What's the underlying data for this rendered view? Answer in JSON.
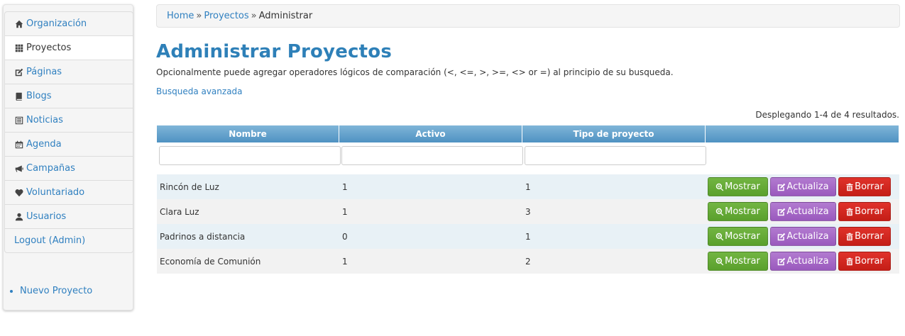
{
  "sidebar": {
    "items": [
      {
        "label": "Organización",
        "icon": "home-icon",
        "active": false
      },
      {
        "label": "Proyectos",
        "icon": "grid-icon",
        "active": true
      },
      {
        "label": "Páginas",
        "icon": "edit-icon",
        "active": false
      },
      {
        "label": "Blogs",
        "icon": "book-icon",
        "active": false
      },
      {
        "label": "Noticias",
        "icon": "list-icon",
        "active": false
      },
      {
        "label": "Agenda",
        "icon": "calendar-icon",
        "active": false
      },
      {
        "label": "Campañas",
        "icon": "bullhorn-icon",
        "active": false
      },
      {
        "label": "Voluntariado",
        "icon": "heart-icon",
        "active": false
      },
      {
        "label": "Usuarios",
        "icon": "user-icon",
        "active": false
      },
      {
        "label": "Logout (Admin)",
        "icon": "",
        "active": false
      }
    ],
    "operations": [
      "Nuevo Proyecto"
    ]
  },
  "breadcrumb": {
    "home": "Home",
    "separator": "»",
    "section": "Proyectos",
    "current": "Administrar"
  },
  "page": {
    "title": "Administrar Proyectos",
    "description": "Opcionalmente puede agregar operadores lógicos de comparación (<, <=, >, >=, <> or =) al principio de su busqueda.",
    "advanced_search": "Busqueda avanzada",
    "summary": "Desplegando 1-4 de 4 resultados."
  },
  "grid": {
    "columns": [
      "Nombre",
      "Activo",
      "Tipo de proyecto",
      ""
    ],
    "filters": [
      "",
      "",
      ""
    ],
    "buttons": {
      "show": "Mostrar",
      "edit": "Actualiza",
      "delete": "Borrar"
    },
    "rows": [
      {
        "nombre": "Rincón de Luz",
        "activo": "1",
        "tipo": "1"
      },
      {
        "nombre": "Clara Luz",
        "activo": "1",
        "tipo": "3"
      },
      {
        "nombre": "Padrinos a distancia",
        "activo": "0",
        "tipo": "1"
      },
      {
        "nombre": "Economía de Comunión",
        "activo": "1",
        "tipo": "2"
      }
    ]
  },
  "colors": {
    "link": "#3080c0",
    "title": "#2e80b8",
    "header_gradient_top": "#7fb5d8",
    "header_gradient_bottom": "#4f92c2",
    "row_odd": "#e8f1f6",
    "row_even": "#f2f2f2",
    "btn_show": "#5aa02c",
    "btn_edit": "#9a59bd",
    "btn_delete": "#c41e17"
  }
}
